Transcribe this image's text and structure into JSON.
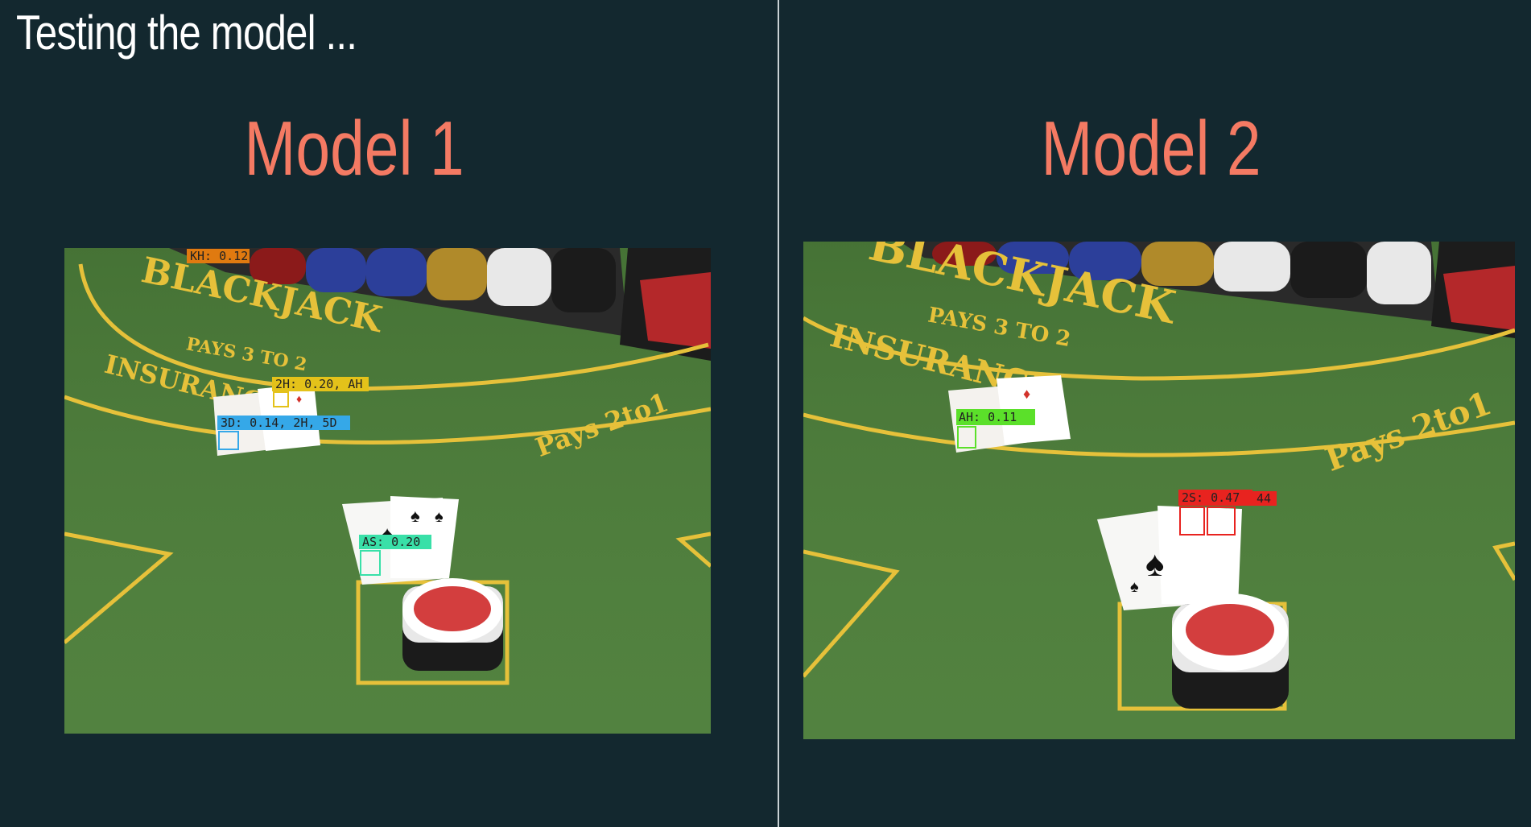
{
  "slide": {
    "title": "Testing the model ..."
  },
  "models": [
    {
      "heading": "Model 1",
      "table": {
        "title": "BLACKJACK",
        "pays_line": "PAYS 3 TO 2",
        "insurance": "INSURANCE",
        "pays_right": "Pays 2to1"
      },
      "detections": [
        {
          "text": "KH: 0.12",
          "color": "#e07a10"
        },
        {
          "text": "2H: 0.20, AH",
          "color": "#e4c21a"
        },
        {
          "text": "3D: 0.14, 2H, 5D",
          "color": "#35a8e8"
        },
        {
          "text": "AS: 0.20",
          "color": "#39e0a8"
        }
      ]
    },
    {
      "heading": "Model 2",
      "table": {
        "title": "BLACKJACK",
        "pays_line": "PAYS 3 TO 2",
        "insurance": "INSURANCE",
        "pays_right": "Pays 2to1"
      },
      "detections": [
        {
          "text": "AH: 0.11",
          "color": "#5be02a"
        },
        {
          "text": "2S: 0.47",
          "color": "#e8231f"
        },
        {
          "text": "44",
          "color": "#e8231f"
        }
      ]
    }
  ],
  "colors": {
    "background": "#13282f",
    "heading": "#f47a63",
    "felt": "#4f7f3d",
    "table_gold": "#e6c13a"
  }
}
